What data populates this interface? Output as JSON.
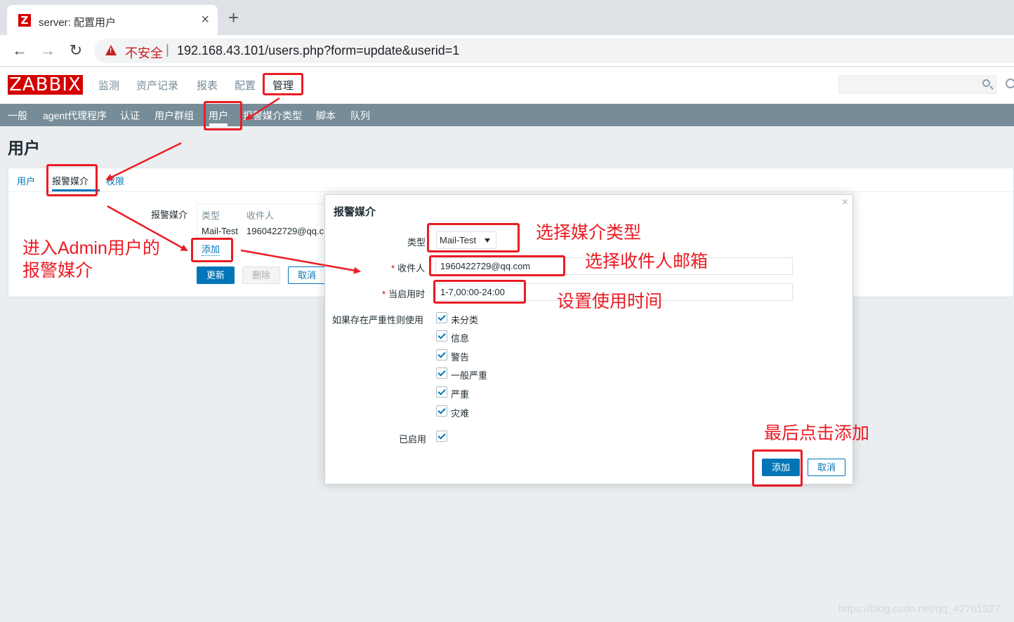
{
  "browser": {
    "tab_title": "server: 配置用户",
    "tab_close": "×",
    "new_tab": "+",
    "back": "←",
    "forward": "→",
    "reload": "↻",
    "insecure": "不安全",
    "separator": "|",
    "url": "192.168.43.101/users.php?form=update&userid=1"
  },
  "header": {
    "logo": "ZABBIX",
    "menu": [
      "监测",
      "资产记录",
      "报表",
      "配置",
      "管理"
    ],
    "active_menu": "管理"
  },
  "subnav": {
    "items": [
      "一般",
      "agent代理程序",
      "认证",
      "用户群组",
      "用户",
      "报警媒介类型",
      "脚本",
      "队列"
    ],
    "active": "用户"
  },
  "page": {
    "title": "用户",
    "tabs": [
      "用户",
      "报警媒介",
      "权限"
    ],
    "active_tab": "报警媒介",
    "media_label": "报警媒介",
    "table_headers": [
      "类型",
      "收件人"
    ],
    "table_rows": [
      [
        "Mail-Test",
        "1960422729@qq.c"
      ]
    ],
    "add_link": "添加",
    "buttons": {
      "update": "更新",
      "delete": "删除",
      "cancel": "取消"
    }
  },
  "dialog": {
    "title": "报警媒介",
    "close": "×",
    "type_label": "类型",
    "type_value": "Mail-Test",
    "recipient_label": "收件人",
    "recipient_value": "1960422729@qq.com",
    "when_label": "当启用时",
    "when_value": "1-7,00:00-24:00",
    "severity_label": "如果存在严重性则使用",
    "severities": [
      {
        "label": "未分类",
        "checked": true
      },
      {
        "label": "信息",
        "checked": true
      },
      {
        "label": "警告",
        "checked": true
      },
      {
        "label": "一般严重",
        "checked": true
      },
      {
        "label": "严重",
        "checked": true
      },
      {
        "label": "灾难",
        "checked": true
      }
    ],
    "enabled_label": "已启用",
    "enabled": true,
    "add_button": "添加",
    "cancel_button": "取消"
  },
  "annotations": {
    "enter_media_line1": "进入Admin用户的",
    "enter_media_line2": "报警媒介",
    "select_type": "选择媒介类型",
    "select_email": "选择收件人邮箱",
    "set_time": "设置使用时间",
    "click_add": "最后点击添加"
  },
  "watermark": "https://blog.csdn.net/qq_42761527",
  "colors": {
    "brand": "#d40000",
    "accent": "#0275b8",
    "annotation": "#ea1c24",
    "subnav": "#768d99"
  }
}
